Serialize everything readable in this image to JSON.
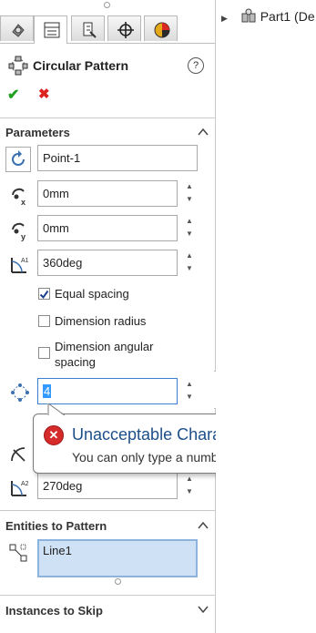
{
  "panel": {
    "title": "Circular Pattern",
    "help_label": "?"
  },
  "tabs": [
    {
      "name": "FeatureManager",
      "icon": "feature-manager-icon"
    },
    {
      "name": "PropertyManager",
      "icon": "property-manager-icon",
      "active": true
    },
    {
      "name": "ConfigurationManager",
      "icon": "configuration-manager-icon"
    },
    {
      "name": "DimXpertManager",
      "icon": "dimxpert-icon"
    },
    {
      "name": "DisplayManager",
      "icon": "display-manager-icon"
    }
  ],
  "actions": {
    "ok_label": "✔",
    "cancel_label": "✖"
  },
  "parameters": {
    "section_title": "Parameters",
    "axis_value": "Point-1",
    "center_x": "0mm",
    "center_y": "0mm",
    "angle": "360deg",
    "equal_spacing_label": "Equal spacing",
    "equal_spacing_checked": true,
    "dimension_radius_label": "Dimension radius",
    "dimension_angular_label_line1": "Dimension angular",
    "dimension_angular_label_line2": "spacing",
    "instances_value": "4",
    "second_angle": "270deg"
  },
  "tooltip": {
    "title": "Unacceptable Character",
    "message": "You can only type a number here."
  },
  "entities": {
    "section_title": "Entities to Pattern",
    "items": [
      "Line1"
    ]
  },
  "instances_to_skip": {
    "section_title": "Instances to Skip"
  },
  "tree": {
    "item": "Part1  (De"
  },
  "colors": {
    "accent_selection": "#cfe1f5",
    "ok_green": "#21a021",
    "cancel_red": "#dd2222",
    "tooltip_title": "#1c4f8a",
    "error_red": "#d52b2b"
  }
}
